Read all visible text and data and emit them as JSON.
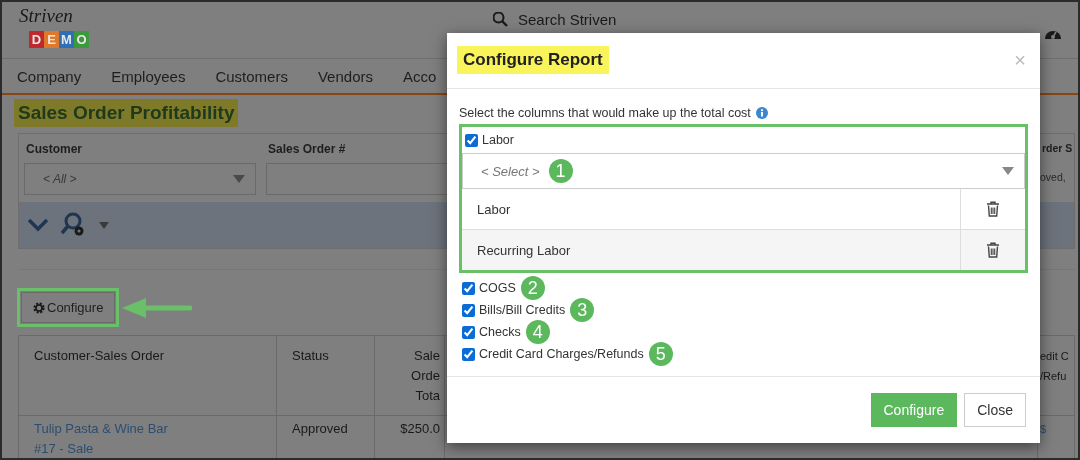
{
  "logo": {
    "wordmark": "Striven",
    "letters": [
      {
        "text": "D",
        "color": "#c0282d"
      },
      {
        "text": "E",
        "color": "#e0782a"
      },
      {
        "text": "M",
        "color": "#2f6fb5"
      },
      {
        "text": "O",
        "color": "#3c9a3c"
      }
    ]
  },
  "search": {
    "placeholder": "Search Striven"
  },
  "nav": {
    "items": [
      "Company",
      "Employees",
      "Customers",
      "Vendors",
      "Acco"
    ]
  },
  "page_title": "Sales Order Profitability",
  "filters": [
    {
      "label": "Customer",
      "kind": "select",
      "value": "< All >"
    },
    {
      "label": "Sales Order #",
      "kind": "text"
    },
    {
      "label": "rder S",
      "kind": "text",
      "value": "oved,"
    }
  ],
  "configure_button": "Configure",
  "table": {
    "columns": [
      {
        "lines": [
          "Customer-Sales Order"
        ]
      },
      {
        "lines": [
          "Status"
        ]
      },
      {
        "lines": [
          "Sale",
          "Orde",
          "Tota"
        ]
      },
      {
        "lines": [
          "edit C",
          "/Refu"
        ]
      }
    ],
    "rows": [
      {
        "cells": [
          {
            "kind": "link",
            "lines": [
              "Tulip Pasta & Wine Bar",
              "#17 - Sale"
            ]
          },
          {
            "kind": "text",
            "lines": [
              "Approved"
            ]
          },
          {
            "kind": "text",
            "lines": [
              "$250.0"
            ]
          },
          {
            "kind": "link",
            "lines": [
              "$"
            ]
          }
        ]
      }
    ]
  },
  "modal": {
    "title": "Configure Report",
    "close": "×",
    "instruction": "Select the columns that would make up the total cost",
    "labor": {
      "label": "Labor",
      "checked": true,
      "select": {
        "placeholder": "< Select >",
        "badge": "1"
      },
      "items": [
        "Labor",
        "Recurring Labor"
      ]
    },
    "options": [
      {
        "label": "COGS",
        "checked": true,
        "badge": "2"
      },
      {
        "label": "Bills/Bill Credits",
        "checked": true,
        "badge": "3"
      },
      {
        "label": "Checks",
        "checked": true,
        "badge": "4"
      },
      {
        "label": "Credit Card Charges/Refunds",
        "checked": true,
        "badge": "5"
      }
    ],
    "buttons": [
      {
        "label": "Configure",
        "kind": "primary"
      },
      {
        "label": "Close",
        "kind": "default"
      }
    ]
  }
}
